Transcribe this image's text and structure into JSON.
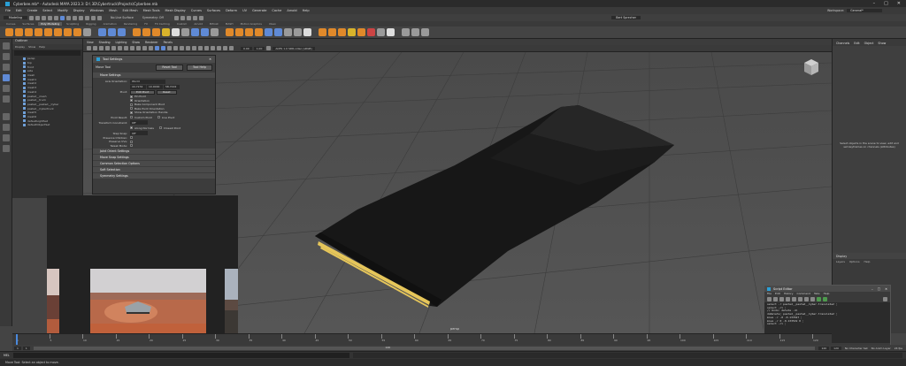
{
  "window": {
    "title": "Cyberbee.mb* - Autodesk MAYA 2023.3: D:\\ 3D\\Cybertruck\\Projects\\Cyberbee.mb",
    "workspace_label": "Workspace:",
    "workspace_value": "General*"
  },
  "menubar": [
    "File",
    "Edit",
    "Create",
    "Select",
    "Modify",
    "Display",
    "Windows",
    "Mesh",
    "Edit Mesh",
    "Mesh Tools",
    "Mesh Display",
    "Curves",
    "Surfaces",
    "Deform",
    "UV",
    "Generate",
    "Cache",
    "Arnold",
    "Help"
  ],
  "statusline": {
    "menuset": "Modeling",
    "no_live_surface": "No Live Surface",
    "symmetry": "Symmetry: Off",
    "signin": "Bert Sprecher"
  },
  "shelf_tabs": [
    "Curves",
    "Surfaces",
    "Poly Modeling",
    "Sculpting",
    "Rigging",
    "Animation",
    "Rendering",
    "FX",
    "FX Caching",
    "Custom",
    "Arnold",
    "Bifrost",
    "MASH",
    "Motion Graphics",
    "XGen"
  ],
  "active_shelf_tab": "Poly Modeling",
  "outliner": {
    "title": "Outliner",
    "menu": [
      "Display",
      "Show",
      "Help"
    ],
    "items": [
      "persp",
      "top",
      "front",
      "side",
      "mesh",
      "mesh1",
      "mesh2",
      "mesh3",
      "mesh4",
      "pasted__mesh",
      "pasted__truck",
      "pasted__pasted__Cyber",
      "pasted__Cybertruck",
      "mesh5",
      "mesh6",
      "defaultLightSet",
      "defaultObjectSet"
    ]
  },
  "viewport": {
    "menu": [
      "View",
      "Shading",
      "Lighting",
      "Show",
      "Renderer",
      "Panels"
    ],
    "camera_label": "persp",
    "color_space": "ACES 1.0 SDR-video (sRGB)",
    "value1": "0.00",
    "value2": "1.00"
  },
  "right_panel": {
    "tabs": [
      "Channels",
      "Edit",
      "Object",
      "Show"
    ],
    "message": "Select objects in the scene to view, edit and set keyframes on channels (attributes)"
  },
  "display_panel": {
    "title": "Display",
    "menu": [
      "Layers",
      "Options",
      "Help"
    ]
  },
  "tool_settings": {
    "title": "Tool Settings",
    "tool_name": "Move Tool",
    "reset_label": "Reset Tool",
    "help_label": "Tool Help",
    "section_move": "Move Settings",
    "axis_orientation_label": "Axis Orientation:",
    "axis_orientation_value": "World",
    "xyz": [
      "44.7232",
      "10.0000",
      "58.7222"
    ],
    "pivot_label": "Pivot:",
    "edit_pivot_label": "Edit Pivot",
    "reset_pivot_label": "Reset",
    "checkboxes": [
      "Pin Pivot",
      "Orientation",
      "Bake Component Pivot",
      "Bake Pivot Orientation",
      "Show Orientation Handle"
    ],
    "pivot_result_label": "Pivot Result:",
    "custom_pivot": "Custom Pivot",
    "live_pivot": "Live Pivot",
    "transform_constraint_label": "Transform Constraint:",
    "transform_constraint_value": "Off",
    "along_normals": "Along Normals",
    "closest_point": "Closest Point",
    "snap_label": "Step Snap:",
    "snap_value": "Off",
    "preserve_children": "Preserve Children:",
    "preserve_uvs": "Preserve UVs:",
    "tweak_mode": "Tweak Mode:",
    "sections": [
      "Joint Orient Settings",
      "Move Snap Settings",
      "Common Selection Options",
      "Soft Selection",
      "Symmetry Settings"
    ]
  },
  "script_editor": {
    "title": "Script Editor",
    "menu": [
      "File",
      "Edit",
      "History",
      "Command",
      "Tabs",
      "Help"
    ],
    "lines": [
      "select -r pasted__pasted__Cyber.translate2 ;",
      "select -cl ;",
      "// Undo: delete -ch",
      "doDelete; pasted__pasted__Cyber.translate2 ;",
      "move -r -0 -0.133547 ;",
      "move -r 0 -0.133519 0 ;",
      "select -cl ;"
    ],
    "mel_label": "MEL",
    "python_label": "Python"
  },
  "timeline": {
    "ticks": [
      "1",
      "5",
      "10",
      "15",
      "20",
      "25",
      "30",
      "35",
      "40",
      "45",
      "50",
      "55",
      "60",
      "65",
      "70",
      "75",
      "80",
      "85",
      "90",
      "95",
      "100",
      "105",
      "110",
      "115",
      "120"
    ],
    "range_start": "1",
    "range_end": "120",
    "current": "1",
    "fps": "24 fps",
    "no_char_set": "No Character Set",
    "no_anim_layer": "No Anim Layer"
  },
  "cmdline": {
    "label": "MEL"
  },
  "help_line": "Move Tool: Select an object to move.",
  "video": {
    "caption": "Cybertruck Desert Drive"
  },
  "colors": {
    "accent_blue": "#5f8ad6",
    "shelf_orange": "#e0892a",
    "stripe_gold": "#e6c65a"
  }
}
